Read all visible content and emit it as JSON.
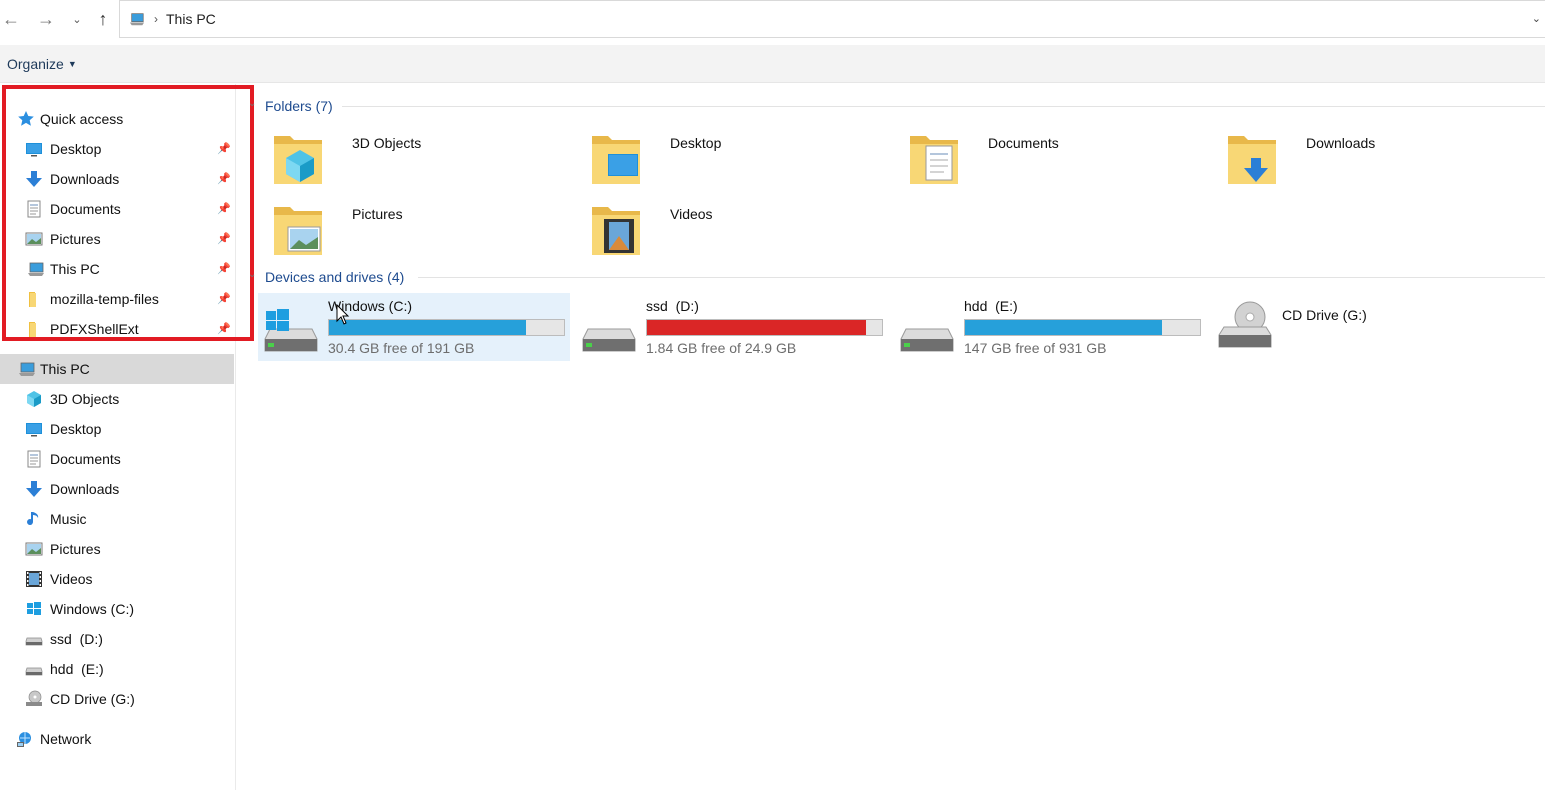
{
  "address_bar": {
    "breadcrumb": "This PC",
    "back_icon": "arrow-left-icon",
    "forward_icon": "arrow-right-icon",
    "recent_icon": "chevron-down-icon",
    "up_icon": "arrow-up-icon"
  },
  "command_bar": {
    "organize_label": "Organize"
  },
  "nav": {
    "quick_access": {
      "label": "Quick access",
      "items": [
        {
          "label": "Desktop",
          "icon": "desktop-icon",
          "pinned": true
        },
        {
          "label": "Downloads",
          "icon": "downloads-icon",
          "pinned": true
        },
        {
          "label": "Documents",
          "icon": "documents-icon",
          "pinned": true
        },
        {
          "label": "Pictures",
          "icon": "pictures-icon",
          "pinned": true
        },
        {
          "label": "This PC",
          "icon": "this-pc-icon",
          "pinned": true
        },
        {
          "label": "mozilla-temp-files",
          "icon": "folder-icon",
          "pinned": true
        },
        {
          "label": "PDFXShellExt",
          "icon": "folder-icon",
          "pinned": true
        }
      ]
    },
    "this_pc": {
      "label": "This PC",
      "items": [
        {
          "label": "3D Objects",
          "icon": "3d-objects-icon"
        },
        {
          "label": "Desktop",
          "icon": "desktop-icon"
        },
        {
          "label": "Documents",
          "icon": "documents-icon"
        },
        {
          "label": "Downloads",
          "icon": "downloads-icon"
        },
        {
          "label": "Music",
          "icon": "music-icon"
        },
        {
          "label": "Pictures",
          "icon": "pictures-icon"
        },
        {
          "label": "Videos",
          "icon": "videos-icon"
        },
        {
          "label": "Windows (C:)",
          "icon": "windows-drive-icon"
        },
        {
          "label": "ssd  (D:)",
          "icon": "drive-icon"
        },
        {
          "label": "hdd  (E:)",
          "icon": "drive-icon"
        },
        {
          "label": "CD Drive (G:)",
          "icon": "cd-drive-icon"
        }
      ]
    },
    "network": {
      "label": "Network",
      "icon": "network-icon"
    }
  },
  "content": {
    "folders_header": "Folders (7)",
    "folders": [
      {
        "name": "3D Objects",
        "icon": "3d-objects-folder-icon"
      },
      {
        "name": "Desktop",
        "icon": "desktop-folder-icon"
      },
      {
        "name": "Documents",
        "icon": "documents-folder-icon"
      },
      {
        "name": "Downloads",
        "icon": "downloads-folder-icon"
      },
      {
        "name": "Pictures",
        "icon": "pictures-folder-icon"
      },
      {
        "name": "Videos",
        "icon": "videos-folder-icon"
      }
    ],
    "drives_header": "Devices and drives (4)",
    "drives": [
      {
        "name": "Windows (C:)",
        "free_text": "30.4 GB free of 191 GB",
        "used_fraction": 0.84,
        "low_space": false,
        "icon": "windows-drive-icon"
      },
      {
        "name": "ssd  (D:)",
        "free_text": "1.84 GB free of 24.9 GB",
        "used_fraction": 0.93,
        "low_space": true,
        "icon": "drive-icon"
      },
      {
        "name": "hdd  (E:)",
        "free_text": "147 GB free of 931 GB",
        "used_fraction": 0.84,
        "low_space": false,
        "icon": "drive-icon"
      },
      {
        "name": "CD Drive (G:)",
        "icon": "cd-drive-icon"
      }
    ]
  },
  "colors": {
    "highlight_box": "#e21b23",
    "usage_bar": "#26a0da",
    "usage_bar_low": "#da2626",
    "group_header_text": "#1e4b8f"
  }
}
